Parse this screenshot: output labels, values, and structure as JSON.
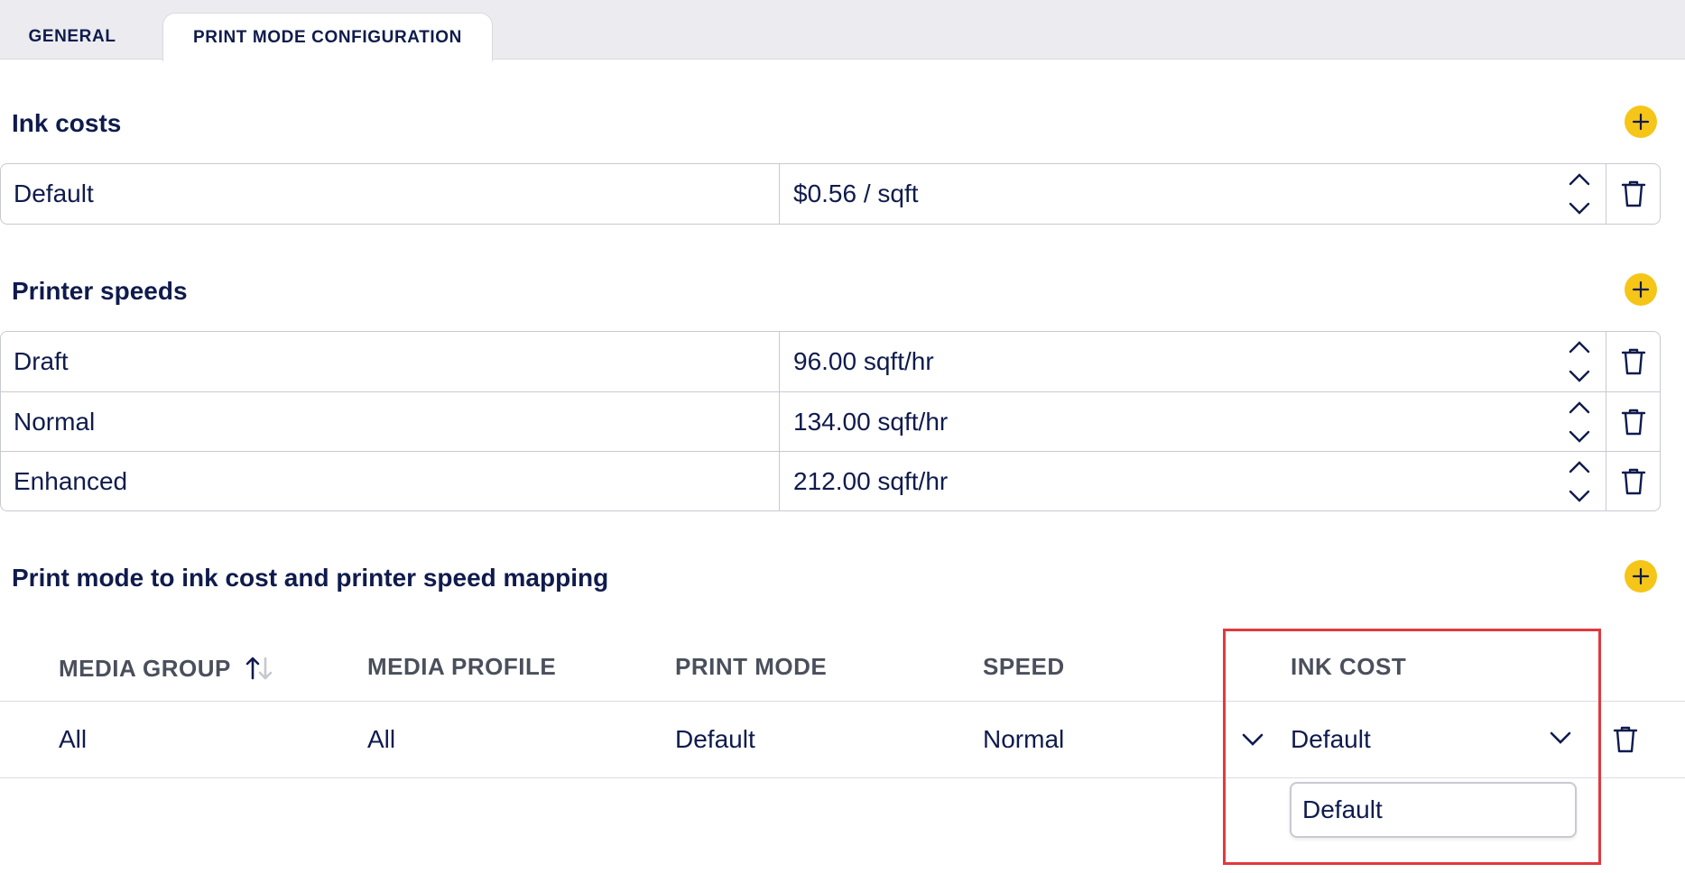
{
  "tabs": [
    {
      "label": "GENERAL",
      "active": false
    },
    {
      "label": "PRINT MODE CONFIGURATION",
      "active": true
    }
  ],
  "ink_costs": {
    "title": "Ink costs",
    "rows": [
      {
        "name": "Default",
        "value": "$0.56 / sqft"
      }
    ]
  },
  "printer_speeds": {
    "title": "Printer speeds",
    "rows": [
      {
        "name": "Draft",
        "value": "96.00 sqft/hr"
      },
      {
        "name": "Normal",
        "value": "134.00 sqft/hr"
      },
      {
        "name": "Enhanced",
        "value": "212.00 sqft/hr"
      }
    ]
  },
  "mapping": {
    "title": "Print mode to ink cost and printer speed mapping",
    "columns": [
      "MEDIA GROUP",
      "MEDIA PROFILE",
      "PRINT MODE",
      "SPEED",
      "INK COST"
    ],
    "rows": [
      {
        "media_group": "All",
        "media_profile": "All",
        "print_mode": "Default",
        "speed": "Normal",
        "ink_cost": "Default"
      }
    ],
    "dropdown_options": [
      "Default"
    ]
  },
  "colors": {
    "accent": "#f5c518",
    "text": "#0f1b4d",
    "highlight": "#e0393e"
  }
}
